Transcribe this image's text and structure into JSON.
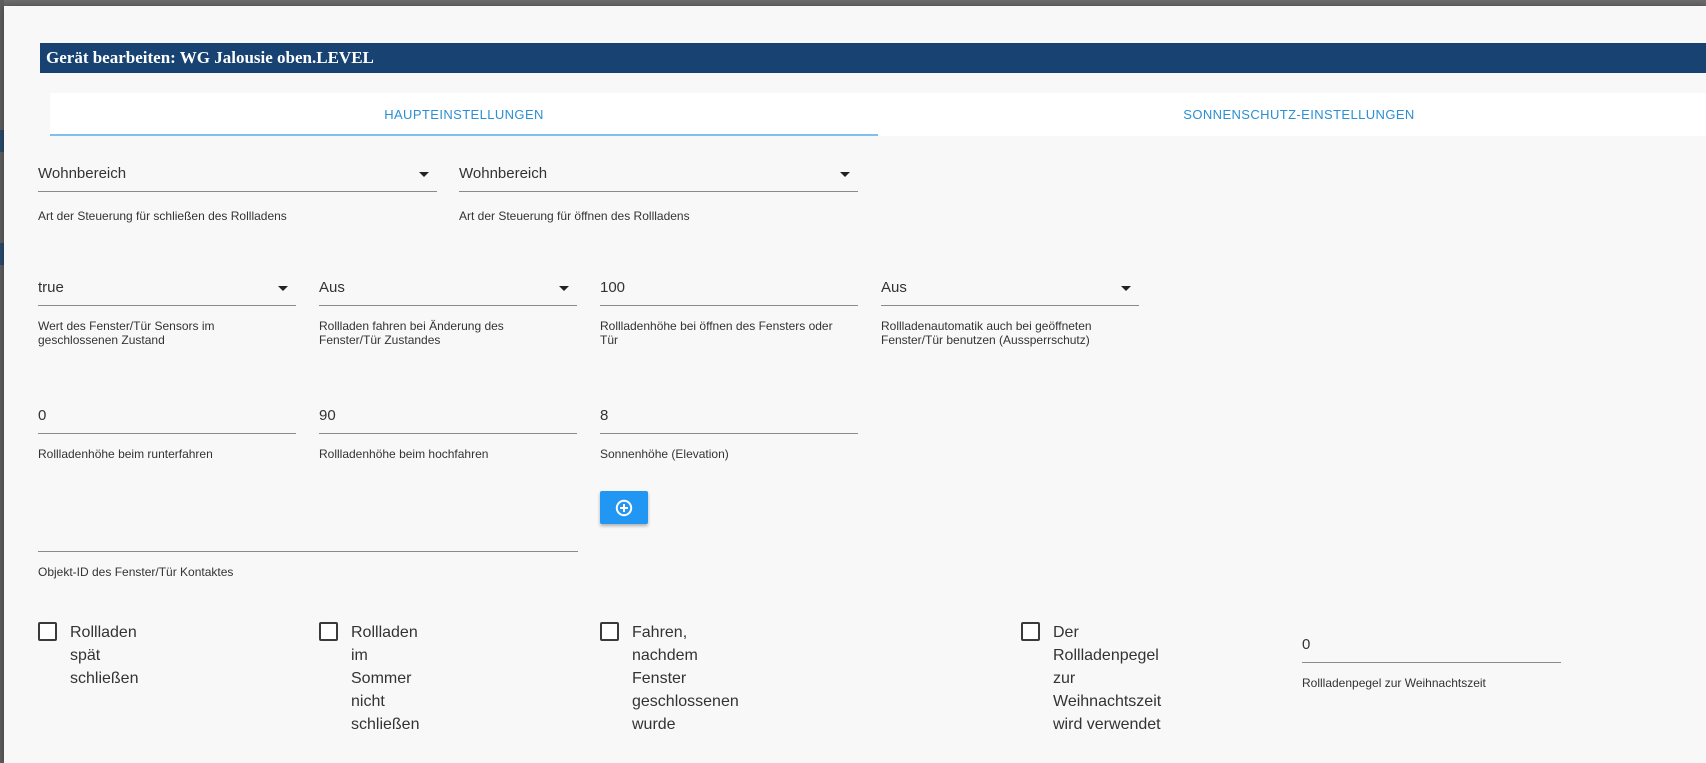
{
  "dialog": {
    "title": "Gerät bearbeiten: WG Jalousie oben.LEVEL"
  },
  "tabs": [
    {
      "label": "HAUPTEINSTELLUNGEN",
      "active": true
    },
    {
      "label": "SONNENSCHUTZ-EINSTELLUNGEN",
      "active": false
    }
  ],
  "row1": {
    "close_type": {
      "value": "Wohnbereich",
      "help": "Art der Steuerung für schließen des Rollladens"
    },
    "open_type": {
      "value": "Wohnbereich",
      "help": "Art der Steuerung für öffnen des Rollladens"
    }
  },
  "row2": {
    "sensor_value": {
      "value": "true",
      "help_l1": "Wert des Fenster/Tür Sensors im",
      "help_l2": "geschlossenen Zustand"
    },
    "drive_on_change": {
      "value": "Aus",
      "help_l1": "Rollladen fahren bei Änderung des",
      "help_l2": "Fenster/Tür Zustandes"
    },
    "height_on_open": {
      "value": "100",
      "help_l1": "Rollladenhöhe bei öffnen des Fensters oder",
      "help_l2": "Tür"
    },
    "lockout": {
      "value": "Aus",
      "help_l1": "Rollladenautomatik auch bei geöffneten",
      "help_l2": "Fenster/Tür benutzen (Aussperrschutz)"
    }
  },
  "row3": {
    "height_down": {
      "value": "0",
      "help": "Rollladenhöhe beim runterfahren"
    },
    "height_up": {
      "value": "90",
      "help": "Rollladenhöhe beim hochfahren"
    },
    "elevation": {
      "value": "8",
      "help": "Sonnenhöhe (Elevation)"
    }
  },
  "object_id": {
    "value": "",
    "help": "Objekt-ID des Fenster/Tür Kontaktes"
  },
  "checkboxes": {
    "late_close": {
      "label": "Rollladen spät schließen",
      "checked": false
    },
    "summer": {
      "label_l1": "Rollladen im Sommer nicht",
      "label_l2": "schließen",
      "checked": false
    },
    "after_window": {
      "label": "Fahren, nachdem Fenster geschlossenen wurde",
      "checked": false
    },
    "christmas": {
      "label_l1": "Der Rollladenpegel zur",
      "label_l2": "Weihnachtszeit wird verwendet",
      "checked": false
    }
  },
  "christmas_level": {
    "value": "0",
    "help": "Rollladenpegel zur Weihnachtszeit"
  },
  "icons": {
    "add": "plus-circle-icon",
    "dropdown": "triangle-down-icon"
  },
  "colors": {
    "title_bar": "#174272",
    "tab_text": "#2b8fd3",
    "button": "#2196f3"
  }
}
